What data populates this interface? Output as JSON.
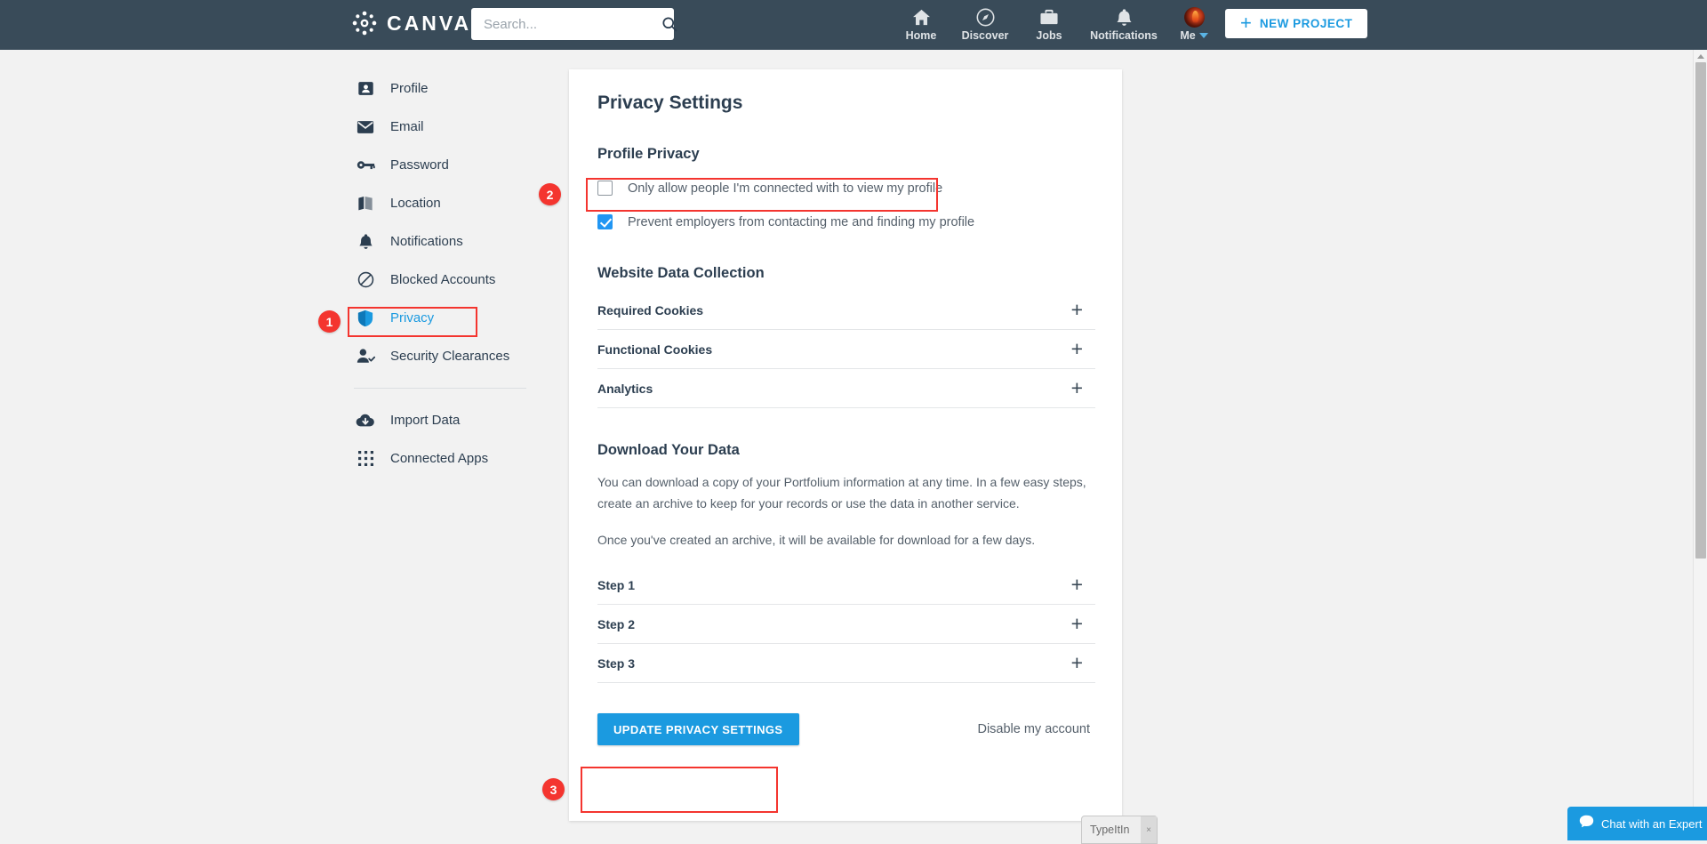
{
  "topnav": {
    "brand": "CANVAS",
    "brand_icon": "canvas-logo-icon",
    "search": {
      "value": "",
      "placeholder": "Search...",
      "icon": "search-icon"
    },
    "items": [
      {
        "label": "Home",
        "icon": "home-icon"
      },
      {
        "label": "Discover",
        "icon": "compass-icon"
      },
      {
        "label": "Jobs",
        "icon": "briefcase-icon"
      },
      {
        "label": "Notifications",
        "icon": "bell-icon"
      },
      {
        "label": "Me",
        "icon": "avatar-icon"
      }
    ],
    "new_project": {
      "label": "NEW PROJECT",
      "icon": "plus-icon"
    },
    "bg_color": "#394b59"
  },
  "sidebar": {
    "items": [
      {
        "label": "Profile",
        "icon": "person-card-icon",
        "active": false
      },
      {
        "label": "Email",
        "icon": "envelope-icon",
        "active": false
      },
      {
        "label": "Password",
        "icon": "key-icon",
        "active": false
      },
      {
        "label": "Location",
        "icon": "map-icon",
        "active": false
      },
      {
        "label": "Notifications",
        "icon": "bell-icon",
        "active": false
      },
      {
        "label": "Blocked Accounts",
        "icon": "block-icon",
        "active": false
      },
      {
        "label": "Privacy",
        "icon": "shield-icon",
        "active": true
      },
      {
        "label": "Security Clearances",
        "icon": "person-check-icon",
        "active": false
      }
    ],
    "items2": [
      {
        "label": "Import Data",
        "icon": "cloud-download-icon"
      },
      {
        "label": "Connected Apps",
        "icon": "grid-apps-icon"
      }
    ]
  },
  "main": {
    "page_title": "Privacy Settings",
    "profile_privacy": {
      "title": "Profile Privacy",
      "checkboxes": [
        {
          "label": "Only allow people I'm connected with to view my profile",
          "checked": false
        },
        {
          "label": "Prevent employers from contacting me and finding my profile",
          "checked": true
        }
      ]
    },
    "website_data": {
      "title": "Website Data Collection",
      "rows": [
        {
          "label": "Required Cookies",
          "icon": "plus-icon"
        },
        {
          "label": "Functional Cookies",
          "icon": "plus-icon"
        },
        {
          "label": "Analytics",
          "icon": "plus-icon"
        }
      ]
    },
    "download": {
      "title": "Download Your Data",
      "paragraph1": "You can download a copy of your Portfolium information at any time. In a few easy steps, create an archive to keep for your records or use the data in another service.",
      "paragraph2": "Once you've created an archive, it will be available for download for a few days.",
      "steps": [
        {
          "label": "Step 1",
          "icon": "plus-icon"
        },
        {
          "label": "Step 2",
          "icon": "plus-icon"
        },
        {
          "label": "Step 3",
          "icon": "plus-icon"
        }
      ]
    },
    "footer": {
      "update_button": "UPDATE PRIVACY SETTINGS",
      "disable_link": "Disable my account",
      "button_color": "#1b9ae0"
    }
  },
  "annotations": {
    "badges": [
      {
        "number": "1"
      },
      {
        "number": "2"
      },
      {
        "number": "3"
      }
    ],
    "color": "#f4352f"
  },
  "widgets": {
    "typeitin": {
      "label": "TypeItIn",
      "close": "×"
    },
    "chat": {
      "label": "Chat with an Expert",
      "icon": "chat-bubble-icon",
      "color": "#1b9ae0"
    }
  }
}
